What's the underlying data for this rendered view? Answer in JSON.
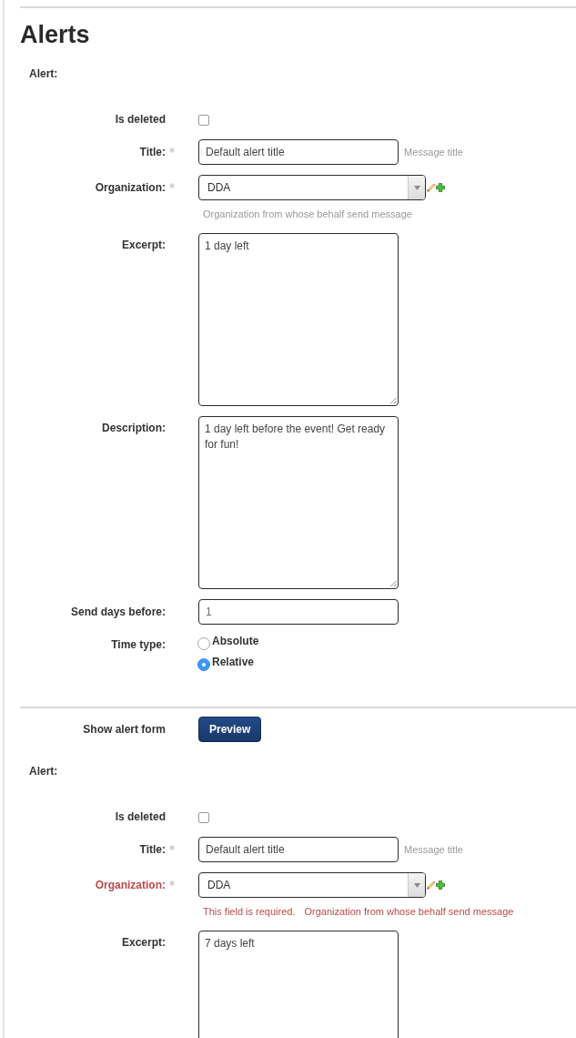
{
  "title": "Alerts",
  "blocks": [
    {
      "kind": "form",
      "heading": "Alert:",
      "fields": [
        {
          "kind": "checkbox",
          "label": "Is deleted",
          "required": false,
          "checked": false
        },
        {
          "kind": "text",
          "label": "Title:",
          "required": true,
          "value": "Default alert title",
          "help": "Message title"
        },
        {
          "kind": "select",
          "label": "Organization:",
          "required": true,
          "value": "DDA",
          "help": "Organization from whose behalf send message"
        },
        {
          "kind": "textarea",
          "label": "Excerpt:",
          "required": false,
          "value": "1 day left"
        },
        {
          "kind": "textarea",
          "label": "Description:",
          "required": false,
          "value": "1 day left before the event! Get ready for fun!"
        },
        {
          "kind": "number",
          "label": "Send days before:",
          "required": false,
          "value": "1"
        },
        {
          "kind": "radio",
          "label": "Time type:",
          "required": false,
          "options": [
            {
              "label": "Absolute",
              "selected": false
            },
            {
              "label": "Relative",
              "selected": true
            }
          ]
        }
      ]
    },
    {
      "kind": "action",
      "label": "Show alert form",
      "button": "Preview"
    },
    {
      "kind": "form",
      "heading": "Alert:",
      "fields": [
        {
          "kind": "checkbox",
          "label": "Is deleted",
          "required": false,
          "checked": false
        },
        {
          "kind": "text",
          "label": "Title:",
          "required": true,
          "value": "Default alert title",
          "help": "Message title"
        },
        {
          "kind": "select",
          "label": "Organization:",
          "required": true,
          "value": "DDA",
          "errors": [
            "This field is required."
          ],
          "help": "Organization from whose behalf send message"
        },
        {
          "kind": "textarea",
          "label": "Excerpt:",
          "required": false,
          "value": "7 days left"
        }
      ]
    }
  ]
}
